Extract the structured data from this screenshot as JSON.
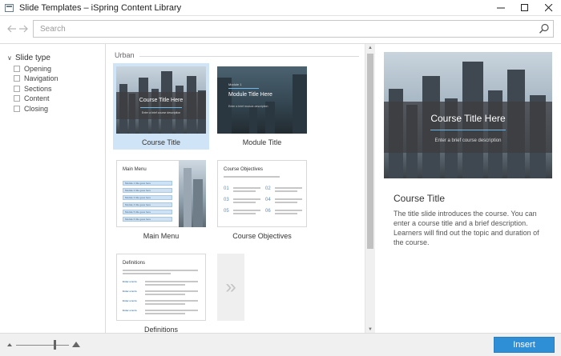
{
  "window": {
    "title": "Slide Templates – iSpring Content Library",
    "minimize_glyph": "—",
    "close_glyph": "✕"
  },
  "nav": {
    "back_icon": "arrow-left-icon",
    "forward_icon": "arrow-right-icon"
  },
  "search": {
    "placeholder": "Search",
    "value": ""
  },
  "sidebar": {
    "filter_title": "Slide type",
    "items": [
      {
        "label": "Opening",
        "checked": false
      },
      {
        "label": "Navigation",
        "checked": false
      },
      {
        "label": "Sections",
        "checked": false
      },
      {
        "label": "Content",
        "checked": false
      },
      {
        "label": "Closing",
        "checked": false
      }
    ]
  },
  "gallery": {
    "group_name": "Urban",
    "templates": [
      {
        "label": "Course Title",
        "selected": true,
        "thumb_title": "Course Title Here",
        "thumb_sub": "Enter a brief course description"
      },
      {
        "label": "Module Title",
        "selected": false,
        "thumb_kicker": "Module 1",
        "thumb_title": "Module Title Here",
        "thumb_sub": "Enter a brief module description"
      },
      {
        "label": "Main Menu",
        "selected": false,
        "thumb_title": "Main Menu",
        "menu_items": [
          "Module 1 title goes here",
          "Module 2 title goes here",
          "Module 3 title goes here",
          "Module 4 title goes here",
          "Module 5 title goes here",
          "Module 6 title goes here"
        ]
      },
      {
        "label": "Course Objectives",
        "selected": false,
        "thumb_title": "Course Objectives",
        "numbers": [
          "01",
          "02",
          "03",
          "04",
          "05",
          "06"
        ]
      },
      {
        "label": "Definitions",
        "selected": false,
        "thumb_title": "Definitions",
        "terms": [
          "Enter a term",
          "Enter a term",
          "Enter a term",
          "Enter a term"
        ]
      }
    ],
    "more_glyph": "»"
  },
  "preview": {
    "image_title": "Course Title Here",
    "image_sub": "Enter a brief course description",
    "title": "Course Title",
    "description": "The title slide introduces the course. You can enter a course title and a brief description. Learners will find out the topic and duration of the course."
  },
  "footer": {
    "insert_label": "Insert",
    "zoom_level": 0.73
  },
  "colors": {
    "accent": "#2f8fd6",
    "selection": "#cfe4f7"
  }
}
